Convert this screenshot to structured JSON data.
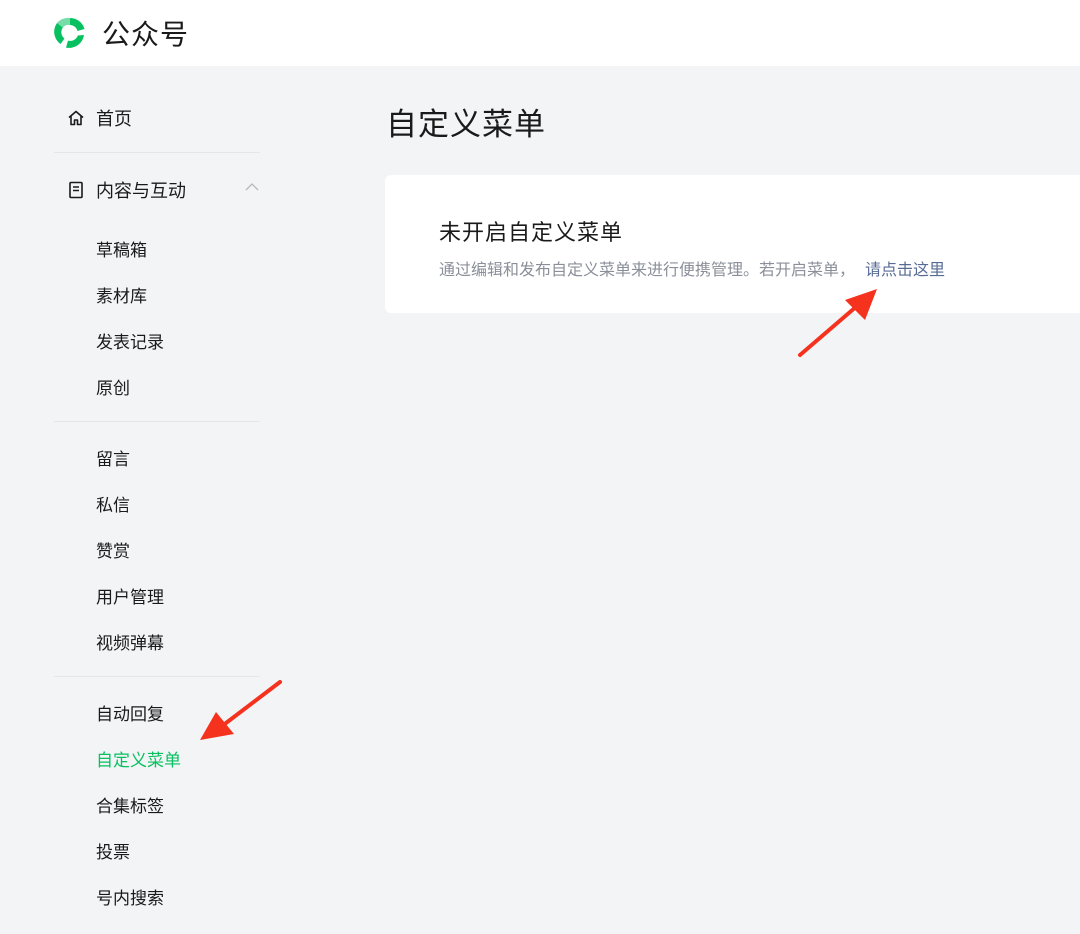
{
  "header": {
    "logo_icon": "wechat-official-account-logo-icon",
    "title": "公众号",
    "brand_color": "#07c160"
  },
  "sidebar": {
    "home": {
      "label": "首页",
      "icon": "home-icon"
    },
    "content_group": {
      "label": "内容与互动",
      "icon": "document-icon",
      "expanded": true
    },
    "group1": [
      "草稿箱",
      "素材库",
      "发表记录",
      "原创"
    ],
    "group2": [
      "留言",
      "私信",
      "赞赏",
      "用户管理",
      "视频弹幕"
    ],
    "group3": [
      "自动回复",
      "自定义菜单",
      "合集标签",
      "投票",
      "号内搜索"
    ],
    "active_item": "自定义菜单"
  },
  "main": {
    "title": "自定义菜单",
    "card": {
      "title": "未开启自定义菜单",
      "description": "通过编辑和发布自定义菜单来进行便携管理。若开启菜单，",
      "link": "请点击这里"
    }
  },
  "annotations": {
    "arrow_color": "#f5321e"
  }
}
